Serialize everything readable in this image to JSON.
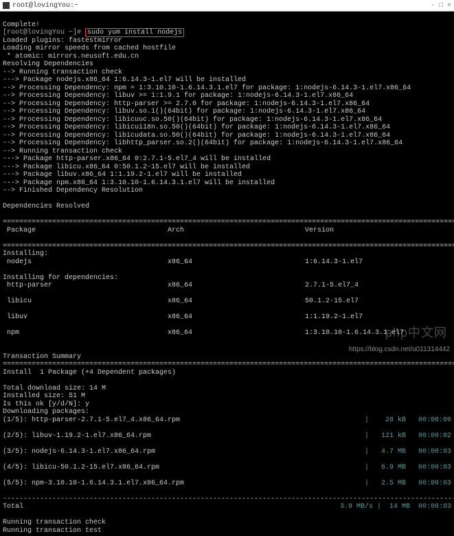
{
  "window": {
    "title": "root@lovingYou:~"
  },
  "titlebar_right": {
    "net": "- □ ×"
  },
  "term": {
    "complete": "Complete!",
    "prompt": "[root@lovingYou ~]#",
    "command": "sudo yum install nodejs",
    "plugins": "Loaded plugins: fastestmirror",
    "mirror1": "Loading mirror speeds from cached hostfile",
    "mirror2": " * atomic: mirrors.neusoft.edu.cn",
    "resolving": "Resolving Dependencies",
    "run_check": "--> Running transaction check",
    "pkg_nodejs": "---> Package nodejs.x86_64 1:6.14.3-1.el7 will be installed",
    "dep1": "--> Processing Dependency: npm = 1:3.10.10-1.6.14.3.1.el7 for package: 1:nodejs-6.14.3-1.el7.x86_64",
    "dep2": "--> Processing Dependency: libuv >= 1:1.9.1 for package: 1:nodejs-6.14.3-1.el7.x86_64",
    "dep3": "--> Processing Dependency: http-parser >= 2.7.0 for package: 1:nodejs-6.14.3-1.el7.x86_64",
    "dep4": "--> Processing Dependency: libuv.so.1()(64bit) for package: 1:nodejs-6.14.3-1.el7.x86_64",
    "dep5": "--> Processing Dependency: libicuuc.so.50()(64bit) for package: 1:nodejs-6.14.3-1.el7.x86_64",
    "dep6": "--> Processing Dependency: libicui18n.so.50()(64bit) for package: 1:nodejs-6.14.3-1.el7.x86_64",
    "dep7": "--> Processing Dependency: libicudata.so.50()(64bit) for package: 1:nodejs-6.14.3-1.el7.x86_64",
    "dep8": "--> Processing Dependency: libhttp_parser.so.2()(64bit) for package: 1:nodejs-6.14.3-1.el7.x86_64",
    "run_check2": "--> Running transaction check",
    "pkg_http": "---> Package http-parser.x86_64 0:2.7.1-5.el7_4 will be installed",
    "pkg_libicu": "---> Package libicu.x86_64 0:50.1.2-15.el7 will be installed",
    "pkg_libuv": "---> Package libuv.x86_64 1:1.19.2-1.el7 will be installed",
    "pkg_npm": "---> Package npm.x86_64 1:3.10.10-1.6.14.3.1.el7 will be installed",
    "finished": "--> Finished Dependency Resolution",
    "deps_resolved": "Dependencies Resolved",
    "hr": "================================================================================================================",
    "hdr_pkg": " Package",
    "hdr_arch": "Arch",
    "hdr_ver": "Version",
    "installing": "Installing:",
    "row_nodejs_n": " nodejs",
    "row_nodejs_a": "x86_64",
    "row_nodejs_v": "1:6.14.3-1.el7",
    "installing_deps": "Installing for dependencies:",
    "row_http_n": " http-parser",
    "row_http_a": "x86_64",
    "row_http_v": "2.7.1-5.el7_4",
    "row_libicu_n": " libicu",
    "row_libicu_a": "x86_64",
    "row_libicu_v": "50.1.2-15.el7",
    "row_libuv_n": " libuv",
    "row_libuv_a": "x86_64",
    "row_libuv_v": "1:1.19.2-1.el7",
    "row_npm_n": " npm",
    "row_npm_a": "x86_64",
    "row_npm_v": "1:3.10.10-1.6.14.3.1.el7",
    "tx_summary": "Transaction Summary",
    "install_line": "Install  1 Package (+4 Dependent packages)",
    "dl_total": "Total download size: 14 M",
    "inst_size": "Installed size: 51 M",
    "ok_prompt": "Is this ok [y/d/N]: y",
    "dl_pkgs": "Downloading packages:",
    "d1": "(1/5): http-parser-2.7.1-5.el7_4.x86_64.rpm",
    "d1s": "28 kB",
    "d1t": "00:00:00",
    "d2": "(2/5): libuv-1.19.2-1.el7.x86_64.rpm",
    "d2s": "121 kB",
    "d2t": "00:00:02",
    "d3": "(3/5): nodejs-6.14.3-1.el7.x86_64.rpm",
    "d3s": "4.7 MB",
    "d3t": "00:00:03",
    "d4": "(4/5): libicu-50.1.2-15.el7.x86_64.rpm",
    "d4s": "6.9 MB",
    "d4t": "00:00:03",
    "d5": "(5/5): npm-3.10.10-1.6.14.3.1.el7.x86_64.rpm",
    "d5s": "2.5 MB",
    "d5t": "00:00:03",
    "dl_hr": "-----------------------------------------------------------------------------------------------------------------",
    "total": "Total",
    "total_speed": "3.9 MB/s |  14 MB  00:00:03",
    "run_tx_check": "Running transaction check",
    "run_tx_test": "Running transaction test"
  },
  "watermark": "php中文网",
  "footer_url": "https://blog.csdn.net/u011314442"
}
